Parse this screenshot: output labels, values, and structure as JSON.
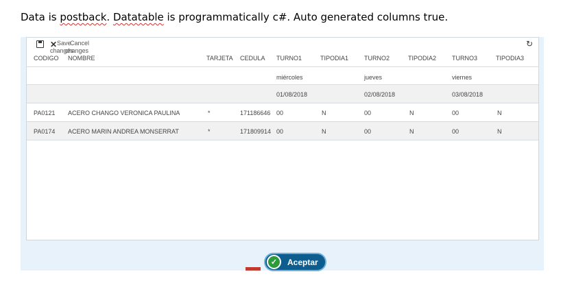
{
  "caption": {
    "p1": "Data is ",
    "w1": "postback",
    "p2": ". ",
    "w2": "Datatable",
    "p3": " is programmatically c#. Auto generated columns true."
  },
  "toolbar": {
    "save_label": "Save",
    "cancel_label": "Cancel",
    "changes_label_1": "changes",
    "changes_label_2": "changes",
    "save_icon": "save-icon",
    "cancel_icon": "close-icon",
    "refresh_icon": "refresh-icon"
  },
  "columns": [
    "CODIGO",
    "NOMBRE",
    "TARJETA",
    "CEDULA",
    "TURNO1",
    "TIPODIA1",
    "TURNO2",
    "TIPODIA2",
    "TURNO3",
    "TIPODIA3"
  ],
  "subheader": {
    "days": [
      "miércoles",
      "jueves",
      "viernes"
    ],
    "dates": [
      "01/08/2018",
      "02/08/2018",
      "03/08/2018"
    ]
  },
  "rows": [
    {
      "codigo": "PA0121",
      "nombre": "ACERO CHANGO VERONICA PAULINA",
      "tarjeta": "*",
      "cedula": "171186646",
      "turno1": "00",
      "tipodia1": "N",
      "turno2": "00",
      "tipodia2": "N",
      "turno3": "00",
      "tipodia3": "N"
    },
    {
      "codigo": "PA0174",
      "nombre": "ACERO MARIN ANDREA MONSERRAT",
      "tarjeta": "*",
      "cedula": "171809914",
      "turno1": "00",
      "tipodia1": "N",
      "turno2": "00",
      "tipodia2": "N",
      "turno3": "00",
      "tipodia3": "N"
    }
  ],
  "footer": {
    "accept_label": "Aceptar",
    "accept_icon": "check-circle-icon"
  },
  "colors": {
    "accent": "#0e5d8f",
    "check": "#2e9a3c",
    "panel_bg": "#e8f2fa"
  }
}
